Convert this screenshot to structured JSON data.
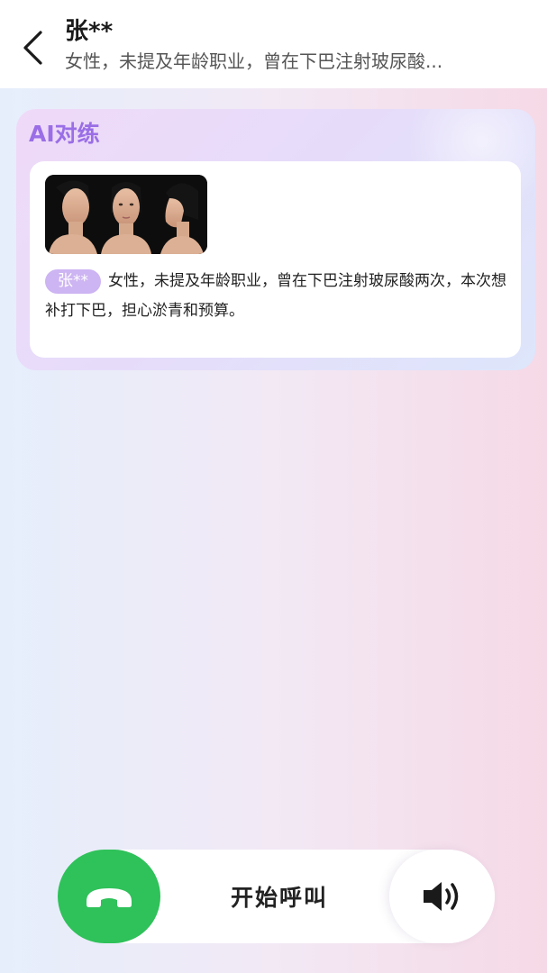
{
  "header": {
    "back_icon": "chevron-left-icon",
    "title": "张**",
    "subtitle": "女性，未提及年龄职业，曾在下巴注射玻尿酸..."
  },
  "ai_card": {
    "title": "AI对练",
    "persona": {
      "name_tag": "张**",
      "description": "女性，未提及年龄职业，曾在下巴注射玻尿酸两次，本次想补打下巴，担心淤青和预算。"
    }
  },
  "call_bar": {
    "call_icon": "phone-icon",
    "label": "开始呼叫",
    "speaker_icon": "speaker-icon",
    "call_color": "#2fc15a"
  },
  "colors": {
    "accent": "#9a6ee6",
    "tag": "#cdb4f2"
  }
}
